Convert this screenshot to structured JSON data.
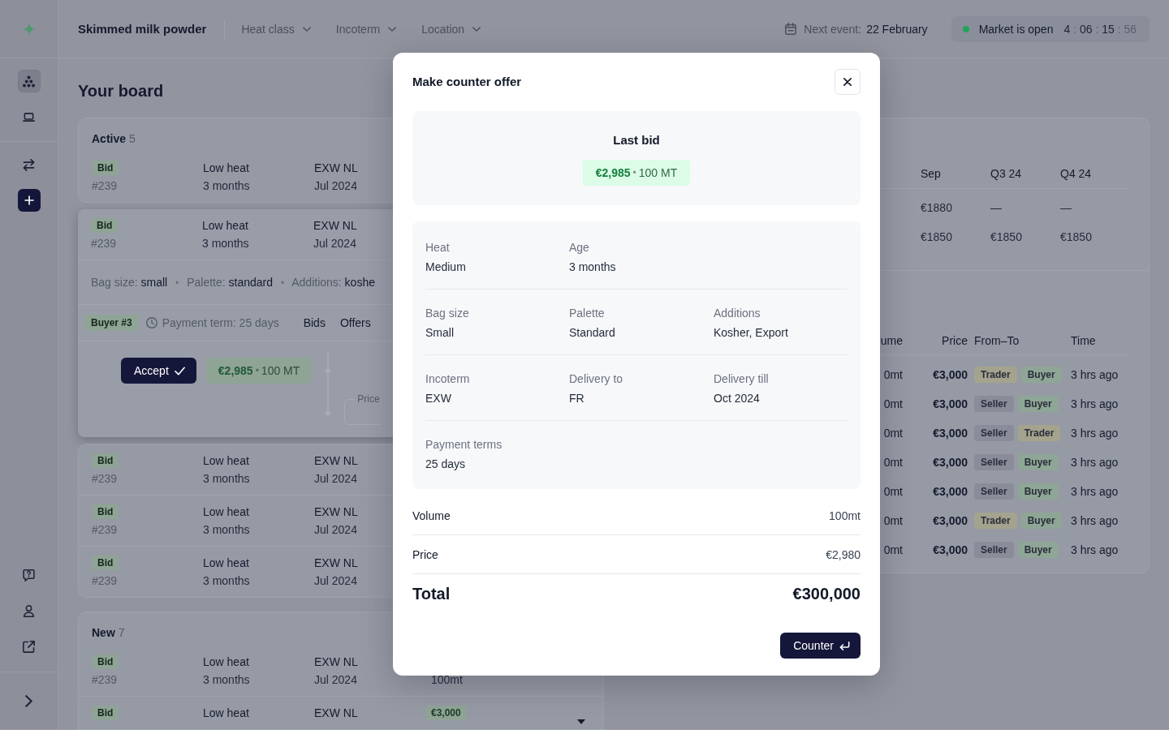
{
  "sidebar": {
    "nav": [
      {
        "selected": true
      },
      {
        "selected": false
      }
    ]
  },
  "topbar": {
    "title": "Skimmed milk powder",
    "filters": [
      {
        "label": "Heat class"
      },
      {
        "label": "Incoterm"
      },
      {
        "label": "Location"
      }
    ],
    "next_event": {
      "label": "Next event:",
      "value": "22 February"
    },
    "market": {
      "status": "Market is open",
      "open": true,
      "countdown": [
        "4",
        "06",
        "15",
        "56"
      ],
      "separator": ":"
    }
  },
  "board": {
    "title": "Your board",
    "active": {
      "title": "Active",
      "count": "5",
      "rows": [
        {
          "type": "Bid",
          "id": "#239",
          "heat": "Low heat",
          "age": "3 months",
          "incoterm": "EXW NL",
          "delivery": "Jul 2024",
          "expanded": false
        },
        {
          "type": "Bid",
          "id": "#239",
          "heat": "Low heat",
          "age": "3 months",
          "incoterm": "EXW NL",
          "delivery": "Jul 2024",
          "expanded": true,
          "details": [
            {
              "label": "Bag size:",
              "value": "small"
            },
            {
              "label": "Palette:",
              "value": "standard"
            },
            {
              "label": "Additions:",
              "value": "koshe"
            }
          ],
          "separator": "•",
          "counterparty": "Buyer #3",
          "payment_term": "Payment term: 25 days",
          "tabs": [
            {
              "label": "Bids"
            },
            {
              "label": "Offers"
            }
          ],
          "accept": "Accept",
          "bid": {
            "price": "€2,985",
            "separator": "•",
            "volume": "100 MT"
          },
          "price_field": {
            "label": "Price"
          }
        },
        {
          "type": "Bid",
          "id": "#239",
          "heat": "Low heat",
          "age": "3 months",
          "incoterm": "EXW NL",
          "delivery": "Jul 2024",
          "expanded": false
        },
        {
          "type": "Bid",
          "id": "#239",
          "heat": "Low heat",
          "age": "3 months",
          "incoterm": "EXW NL",
          "delivery": "Jul 2024",
          "expanded": false
        },
        {
          "type": "Bid",
          "id": "#239",
          "heat": "Low heat",
          "age": "3 months",
          "incoterm": "EXW NL",
          "delivery": "Jul 2024",
          "expanded": false
        }
      ]
    },
    "new": {
      "title": "New",
      "count": "7",
      "rows": [
        {
          "type": "Bid",
          "id": "#239",
          "heat": "Low heat",
          "age": "3 months",
          "incoterm": "EXW NL",
          "delivery": "Jul 2024",
          "volume": "100mt",
          "expanded": false
        },
        {
          "type": "Bid",
          "heat": "Low heat",
          "incoterm": "EXW NL",
          "price": "€3,000",
          "expanded": false,
          "toggle": true
        }
      ]
    },
    "prices": {
      "columns": [
        "Sep",
        "Q3 24",
        "Q4 24"
      ],
      "rows": [
        [
          "€1880",
          "—",
          "—"
        ],
        [
          "€1850",
          "€1850",
          "€1850"
        ]
      ]
    },
    "trades": {
      "columns": {
        "volume": "ume",
        "price": "Price",
        "parties": "From–To",
        "time": "Time"
      },
      "rows": [
        {
          "volume": "0mt",
          "price": "€3,000",
          "from": {
            "label": "Trader",
            "color": "#a4a38d"
          },
          "to": {
            "label": "Buyer",
            "color": "#8ea696"
          },
          "time": "3 hrs ago"
        },
        {
          "volume": "0mt",
          "price": "€3,000",
          "from": {
            "label": "Seller",
            "color": "#8a8d99"
          },
          "to": {
            "label": "Buyer",
            "color": "#8ea696"
          },
          "time": "3 hrs ago"
        },
        {
          "volume": "0mt",
          "price": "€3,000",
          "from": {
            "label": "Seller",
            "color": "#8a8d99"
          },
          "to": {
            "label": "Trader",
            "color": "#a4a38d"
          },
          "time": "3 hrs ago"
        },
        {
          "volume": "0mt",
          "price": "€3,000",
          "from": {
            "label": "Seller",
            "color": "#8a8d99"
          },
          "to": {
            "label": "Buyer",
            "color": "#8ea696"
          },
          "time": "3 hrs ago"
        },
        {
          "volume": "0mt",
          "price": "€3,000",
          "from": {
            "label": "Seller",
            "color": "#8a8d99"
          },
          "to": {
            "label": "Buyer",
            "color": "#8ea696"
          },
          "time": "3 hrs ago"
        },
        {
          "volume": "0mt",
          "price": "€3,000",
          "from": {
            "label": "Trader",
            "color": "#a4a38d"
          },
          "to": {
            "label": "Buyer",
            "color": "#8ea696"
          },
          "time": "3 hrs ago"
        },
        {
          "volume": "0mt",
          "price": "€3,000",
          "from": {
            "label": "Seller",
            "color": "#8a8d99"
          },
          "to": {
            "label": "Buyer",
            "color": "#8ea696"
          },
          "time": "3 hrs ago"
        }
      ]
    }
  },
  "modal": {
    "title": "Make counter offer",
    "last_bid": {
      "label": "Last bid",
      "price": "€2,985",
      "separator": "•",
      "volume": "100 MT"
    },
    "details": [
      [
        {
          "label": "Heat",
          "value": "Medium"
        },
        {
          "label": "Age",
          "value": "3 months"
        }
      ],
      [
        {
          "label": "Bag size",
          "value": "Small"
        },
        {
          "label": "Palette",
          "value": "Standard"
        },
        {
          "label": "Additions",
          "value": "Kosher, Export"
        }
      ],
      [
        {
          "label": "Incoterm",
          "value": "EXW"
        },
        {
          "label": "Delivery to",
          "value": "FR"
        },
        {
          "label": "Delivery till",
          "value": "Oct 2024"
        }
      ],
      [
        {
          "label": "Payment terms",
          "value": "25 days"
        }
      ]
    ],
    "summary": [
      {
        "label": "Volume",
        "value": "100mt"
      },
      {
        "label": "Price",
        "value": "€2,980"
      }
    ],
    "total": {
      "label": "Total",
      "value": "€300,000"
    },
    "submit": "Counter"
  }
}
